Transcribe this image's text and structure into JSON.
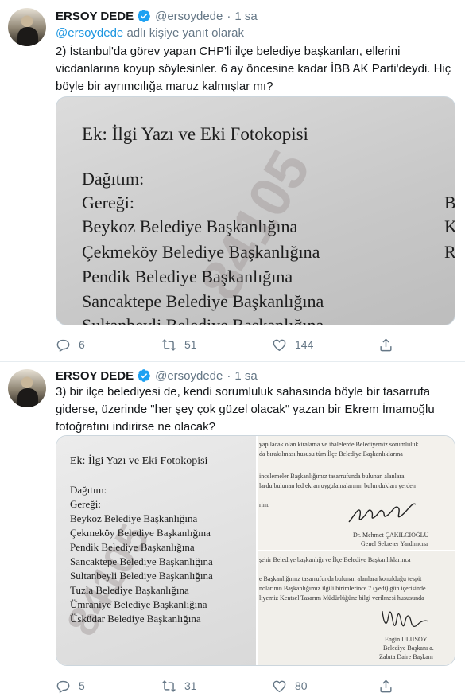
{
  "tweets": [
    {
      "name": "ERSOY DEDE",
      "handle": "@ersoydede",
      "time": "1 sa",
      "reply_mention": "@ersoydede",
      "reply_suffix": " adlı kişiye yanıt olarak",
      "text": "2) İstanbul'da görev yapan CHP'li ilçe belediye başkanları, ellerini vicdanlarına koyup söylesinler. 6 ay öncesine kadar İBB AK Parti'deydi. Hiç böyle bir ayrımcılığa maruz kalmışlar mı?",
      "media": {
        "title": "Ek: İlgi Yazı ve Eki Fotokopisi",
        "lines": [
          "Dağıtım:",
          "Gereği:",
          "Beykoz Belediye Başkanlığına",
          "Çekmeköy Belediye Başkanlığına",
          "Pendik Belediye Başkanlığına",
          "Sancaktepe Belediye Başkanlığına",
          "Sultanbeyli Belediye Başkanlığına"
        ],
        "right_edge": [
          "Bi",
          "K",
          "R"
        ],
        "watermark": "84105"
      },
      "replies": "6",
      "retweets": "51",
      "likes": "144"
    },
    {
      "name": "ERSOY DEDE",
      "handle": "@ersoydede",
      "time": "1 sa",
      "text": "3) bir ilçe belediyesi de, kendi sorumluluk sahasında böyle bir tasarrufa giderse, üzerinde \"her şey çok güzel olacak\" yazan bir Ekrem İmamoğlu fotoğrafını indirirse ne olacak?",
      "media": {
        "title": "Ek: İlgi Yazı ve Eki Fotokopisi",
        "lines": [
          "Dağıtım:",
          "Gereği:",
          "Beykoz Belediye Başkanlığına",
          "Çekmeköy Belediye Başkanlığına",
          "Pendik Belediye Başkanlığına",
          "Sancaktepe Belediye Başkanlığına",
          "Sultanbeyli Belediye Başkanlığına",
          "Tuzla Belediye Başkanlığına",
          "Ümraniye Belediye Başkanlığına",
          "Üsküdar Belediye Başkanlığına"
        ],
        "watermark": "84105",
        "rt_lines": [
          "yapılacak olan kiralama ve ihalelerde Belediyemiz sorumluluk",
          "da bırakılması hususu tüm İlçe Belediye Başkanlıklarına",
          "incelemeler Başkanlığımız tasarrufunda bulunan alanlara",
          "lardu bulunan led ekran uygulamalarının bulundukları yerden",
          "rim."
        ],
        "rt_sign_name": "Dr. Mehmet ÇAKILCIOĞLU",
        "rt_sign_title": "Genel Sekreter Yardımcısı",
        "rb_lines": [
          "şehir Belediye başkanlığı ve İlçe Belediye Başkanlıklarınca",
          "e Başkanlığımız tasarrufunda bulunan alanlara konulduğu tespit",
          "nolarının Başkanlığımız ilgili birimlerince 7 (yedi) gün içerisinde",
          "liyemiz Kentsel Tasarım Müdürlüğüne bilgi verilmesi hususunda"
        ],
        "rb_sign_name": "Engin ULUSOY",
        "rb_sign_title1": "Belediye Başkanı a.",
        "rb_sign_title2": "Zabıta Daire Başkanı"
      },
      "replies": "5",
      "retweets": "31",
      "likes": "80"
    }
  ],
  "colors": {
    "link": "#1b95e0",
    "verified": "#1da1f2",
    "muted": "#657786",
    "border": "#e6ecf0"
  },
  "icons": {
    "verified": "verified-badge-icon",
    "reply": "reply-icon",
    "retweet": "retweet-icon",
    "like": "heart-icon",
    "share": "share-icon"
  }
}
